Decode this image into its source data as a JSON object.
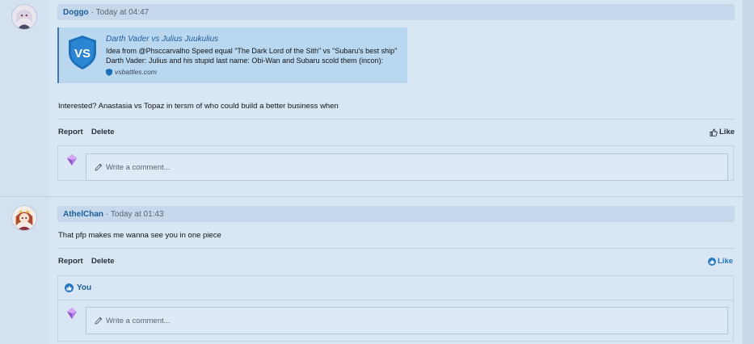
{
  "posts": [
    {
      "username": "Doggo",
      "timestamp": "· Today at 04:47",
      "embed": {
        "title": "Darth Vader vs Julius Juukulius",
        "description": "Idea from @Phsccarvalho Speed equal \"The Dark Lord of the Sith\" vs \"Subaru's best ship\" Darth Vader: Julius and his stupid last name: Obi-Wan and Subaru scold them (incon):",
        "site": "vsbattles.com",
        "logo_text": "VS"
      },
      "text": "Interested? Anastasia vs Topaz in tersm of who could build a better business when",
      "actions": {
        "report": "Report",
        "delete": "Delete"
      },
      "like_label": "Like",
      "comment_placeholder": "Write a comment..."
    },
    {
      "username": "AthelChan",
      "timestamp": "· Today at 01:43",
      "text": "That pfp makes me wanna see you in one piece",
      "actions": {
        "report": "Report",
        "delete": "Delete"
      },
      "like_label": "Like",
      "reactions": {
        "reactor": "You"
      },
      "comment_placeholder": "Write a comment..."
    }
  ],
  "colors": {
    "link": "#1f5d99",
    "like_active": "#2577c1",
    "header_bg": "#c6d8ec",
    "embed_bg": "#b9d8f0"
  },
  "icons": [
    "thumbs-up-icon",
    "pencil-icon",
    "vs-shield-logo",
    "like-reaction-icon"
  ]
}
